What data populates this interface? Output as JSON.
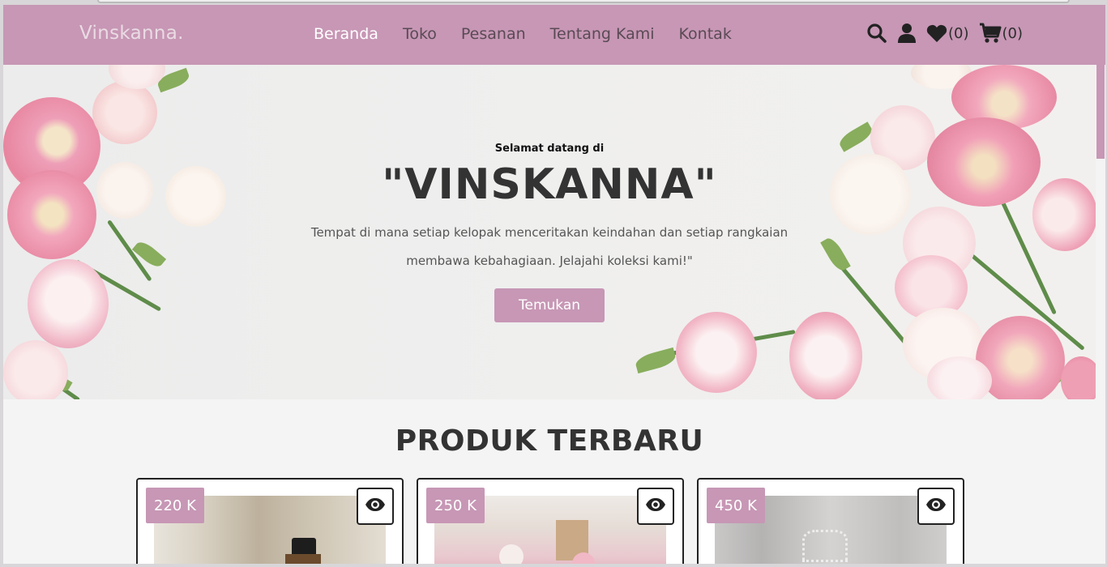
{
  "header": {
    "logo": "Vinskanna.",
    "nav": [
      {
        "label": "Beranda",
        "active": true
      },
      {
        "label": "Toko",
        "active": false
      },
      {
        "label": "Pesanan",
        "active": false
      },
      {
        "label": "Tentang Kami",
        "active": false
      },
      {
        "label": "Kontak",
        "active": false
      }
    ],
    "icons": {
      "search": "search-icon",
      "user": "user-icon",
      "wishlist": "heart-icon",
      "cart": "cart-icon"
    },
    "wishlist_count": "(0)",
    "cart_count": "(0)"
  },
  "hero": {
    "welcome": "Selamat datang di",
    "brand": "\"VINSKANNA\"",
    "description": "Tempat di mana setiap kelopak menceritakan keindahan dan setiap rangkaian membawa kebahagiaan. Jelajahi koleksi kami!\"",
    "cta_label": "Temukan"
  },
  "products": {
    "title": "PRODUK TERBARU",
    "items": [
      {
        "price": "220 K",
        "image": "bouquet-photo-1"
      },
      {
        "price": "250 K",
        "image": "bouquet-photo-2"
      },
      {
        "price": "450 K",
        "image": "bouquet-photo-3"
      }
    ]
  },
  "colors": {
    "brand": "#c797b5",
    "text_dark": "#333333",
    "background": "#f4f4f4"
  }
}
